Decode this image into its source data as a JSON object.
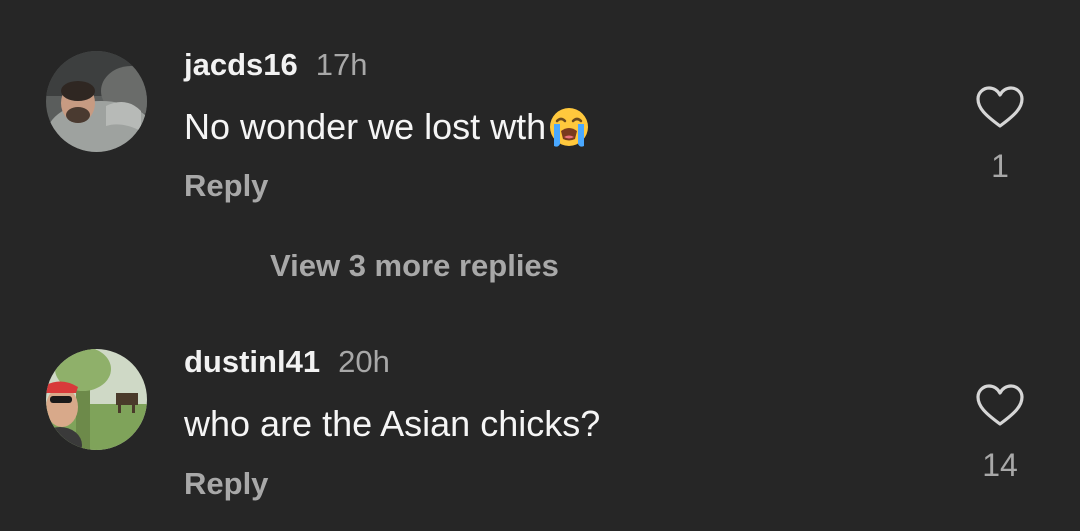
{
  "comments": [
    {
      "username": "jacds16",
      "time": "17h",
      "text": "No wonder we lost wth",
      "emoji": "loudly-crying-face-icon",
      "reply_label": "Reply",
      "likes": "1"
    },
    {
      "username": "dustinl41",
      "time": "20h",
      "text": "who are the Asian chicks?",
      "reply_label": "Reply",
      "likes": "14"
    }
  ],
  "view_more_label": "View 3 more replies",
  "colors": {
    "background": "#262626",
    "primary_text": "#f5f5f5",
    "secondary_text": "#a8a8a8"
  }
}
